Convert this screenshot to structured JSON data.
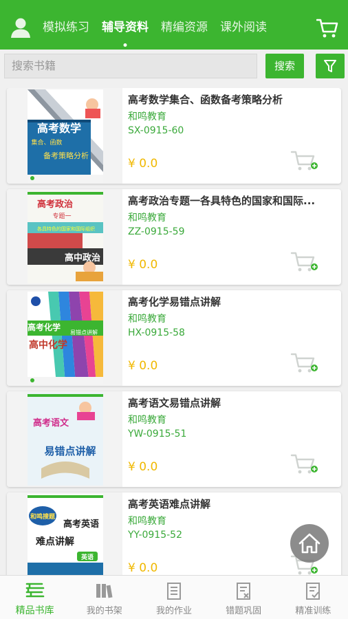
{
  "header": {
    "tabs": [
      {
        "label": "模拟练习",
        "active": false
      },
      {
        "label": "辅导资料",
        "active": true
      },
      {
        "label": "精编资源",
        "active": false
      },
      {
        "label": "课外阅读",
        "active": false
      }
    ],
    "avatar_icon": "user-icon",
    "cart_icon": "cart-icon"
  },
  "search": {
    "placeholder": "搜索书籍",
    "button_label": "搜索",
    "filter_icon": "filter-icon"
  },
  "books": [
    {
      "title": "高考数学集合、函数备考策略分析",
      "publisher": "和鸣教育",
      "code": "SX-0915-60",
      "price": "¥ 0.0",
      "cover": {
        "title": "高考数学",
        "subtitle1": "集合、函数",
        "subtitle2": "备考策略分析"
      }
    },
    {
      "title": "高考政治专题一各具特色的国家和国际...",
      "publisher": "和鸣教育",
      "code": "ZZ-0915-59",
      "price": "¥ 0.0",
      "cover": {
        "title": "高考政治",
        "subtitle1": "专题一",
        "subtitle2": "各具特色的国家和国际组织",
        "subject": "高中政治"
      }
    },
    {
      "title": "高考化学易错点讲解",
      "publisher": "和鸣教育",
      "code": "HX-0915-58",
      "price": "¥ 0.0",
      "cover": {
        "title": "高考化学",
        "subtitle1": "易错点讲解",
        "subject": "高中化学"
      }
    },
    {
      "title": "高考语文易错点讲解",
      "publisher": "和鸣教育",
      "code": "YW-0915-51",
      "price": "¥ 0.0",
      "cover": {
        "title": "高考语文",
        "subtitle1": "易错点讲解"
      }
    },
    {
      "title": "高考英语难点讲解",
      "publisher": "和鸣教育",
      "code": "YY-0915-52",
      "price": "¥ 0.0",
      "cover": {
        "title": "高考英语",
        "subtitle1": "难点讲解",
        "badge": "和鸣搜题",
        "tag": "英语"
      }
    }
  ],
  "bottom_nav": [
    {
      "label": "精品书库",
      "icon": "library-icon",
      "active": true
    },
    {
      "label": "我的书架",
      "icon": "bookshelf-icon",
      "active": false
    },
    {
      "label": "我的作业",
      "icon": "homework-icon",
      "active": false
    },
    {
      "label": "错题巩固",
      "icon": "error-review-icon",
      "active": false
    },
    {
      "label": "精准训练",
      "icon": "training-icon",
      "active": false
    }
  ],
  "colors": {
    "brand": "#3cb530",
    "price": "#f0b800",
    "text_green": "#3aa93a"
  }
}
